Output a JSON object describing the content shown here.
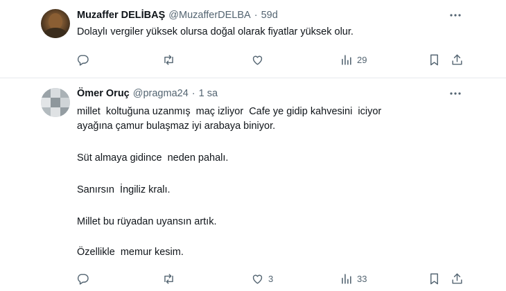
{
  "tweets": [
    {
      "author_name": "Muzaffer DELİBAŞ",
      "handle": "@MuzafferDELBA",
      "separator": "·",
      "time": "59d",
      "lines": [
        "Dolaylı vergiler yüksek olursa doğal olarak fiyatlar yüksek olur."
      ],
      "stats": {
        "replies": "",
        "retweets": "",
        "likes": "",
        "views": "29"
      }
    },
    {
      "author_name": "Ömer Oruç",
      "handle": "@pragma24",
      "separator": "·",
      "time": "1 sa",
      "lines": [
        "millet  koltuğuna uzanmış  maç izliyor  Cafe ye gidip kahvesini  iciyor",
        "ayağına çamur bulaşmaz iyi arabaya biniyor.",
        "Süt almaya gidince  neden pahalı.",
        "Sanırsın  İngiliz kralı.",
        "Millet bu rüyadan uyansın artık.",
        "Özellikle  memur kesim."
      ],
      "stats": {
        "replies": "",
        "retweets": "",
        "likes": "3",
        "views": "33"
      }
    }
  ],
  "colors": {
    "text": "#0f1419",
    "muted": "#536471",
    "divider": "#e6e9ec"
  },
  "icons": [
    "more-icon",
    "reply-icon",
    "retweet-icon",
    "like-icon",
    "views-icon",
    "bookmark-icon",
    "share-icon"
  ]
}
